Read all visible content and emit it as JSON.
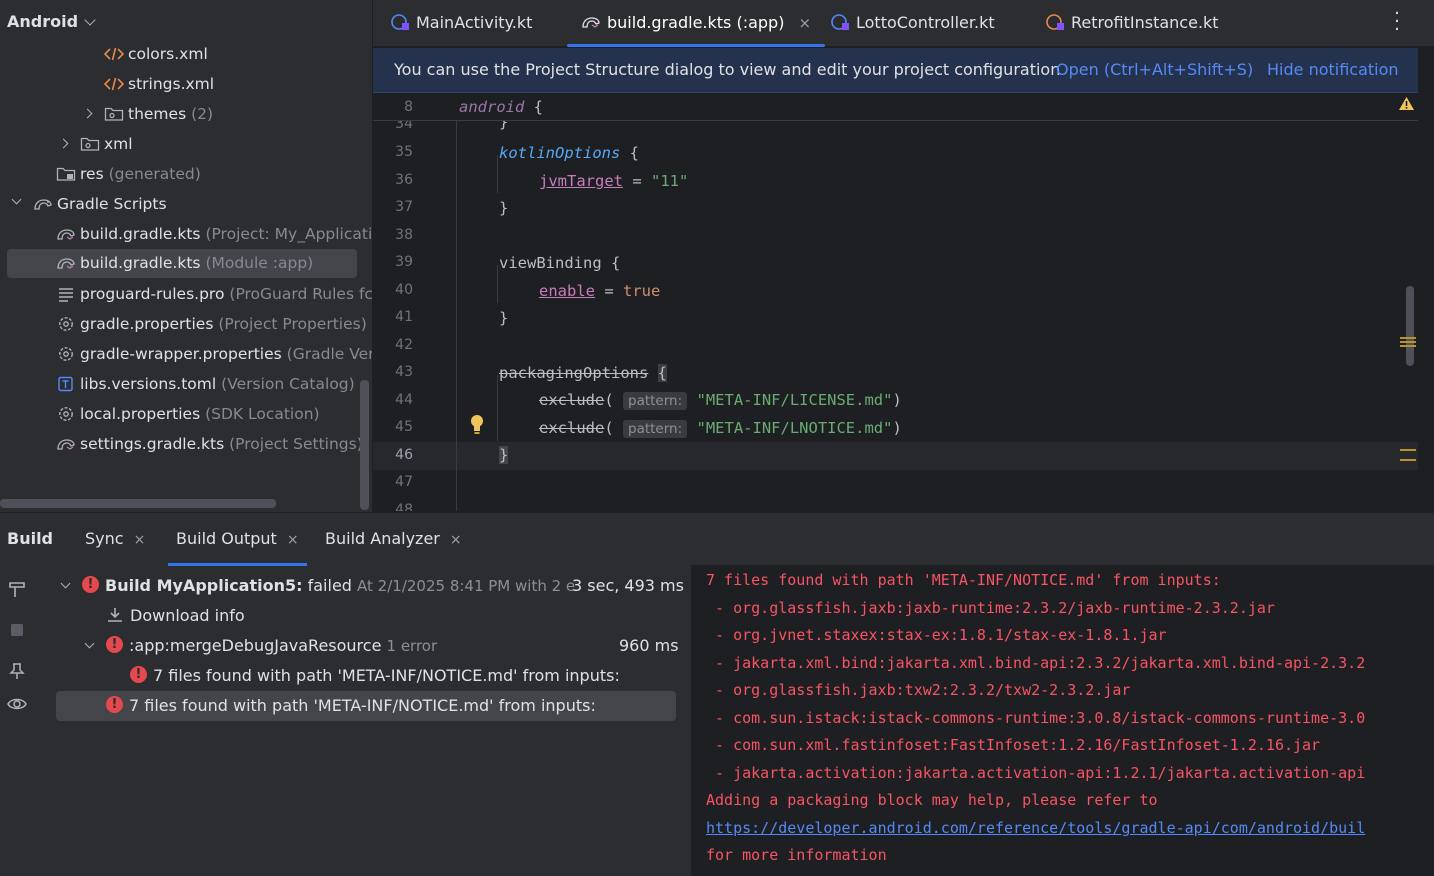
{
  "project_panel": {
    "header": "Android",
    "items": [
      {
        "label": "colors.xml",
        "secondary": "",
        "icon": "xml-file-icon"
      },
      {
        "label": "strings.xml",
        "secondary": "",
        "icon": "xml-file-icon"
      },
      {
        "label": "themes",
        "secondary": "(2)",
        "icon": "folder-icon"
      },
      {
        "label": "xml",
        "secondary": "",
        "icon": "folder-icon"
      },
      {
        "label": "res",
        "secondary": "(generated)",
        "icon": "res-folder-icon"
      },
      {
        "label": "Gradle Scripts",
        "secondary": "",
        "icon": "gradle-icon"
      },
      {
        "label": "build.gradle.kts",
        "secondary": "(Project: My_Applicati",
        "icon": "gradle-icon"
      },
      {
        "label": "build.gradle.kts",
        "secondary": "(Module :app)",
        "icon": "gradle-icon"
      },
      {
        "label": "proguard-rules.pro",
        "secondary": "(ProGuard Rules fc",
        "icon": "text-file-icon"
      },
      {
        "label": "gradle.properties",
        "secondary": "(Project Properties)",
        "icon": "gear-icon"
      },
      {
        "label": "gradle-wrapper.properties",
        "secondary": "(Gradle Ver",
        "icon": "gear-icon"
      },
      {
        "label": "libs.versions.toml",
        "secondary": "(Version Catalog)",
        "icon": "toml-file-icon"
      },
      {
        "label": "local.properties",
        "secondary": "(SDK Location)",
        "icon": "gear-icon"
      },
      {
        "label": "settings.gradle.kts",
        "secondary": "(Project Settings)",
        "icon": "gradle-icon"
      }
    ]
  },
  "editor_tabs": [
    {
      "label": "MainActivity.kt",
      "active": false,
      "icon": "kotlin-class-icon"
    },
    {
      "label": "build.gradle.kts (:app)",
      "active": true,
      "icon": "gradle-icon",
      "close": "×"
    },
    {
      "label": "LottoController.kt",
      "active": false,
      "icon": "kotlin-class-icon"
    },
    {
      "label": "RetrofitInstance.kt",
      "active": false,
      "icon": "kotlin-class-icon"
    }
  ],
  "notification": {
    "message": "You can use the Project Structure dialog to view and edit your project configuration",
    "open_link": "Open (Ctrl+Alt+Shift+S)",
    "hide_link": "Hide notification"
  },
  "editor": {
    "sticky_line": {
      "number": "8",
      "text": "android",
      "brace": "{"
    },
    "line_numbers": [
      "34",
      "35",
      "36",
      "37",
      "38",
      "39",
      "40",
      "41",
      "42",
      "43",
      "44",
      "45",
      "46",
      "47",
      "48"
    ],
    "current_line": "46",
    "code": {
      "l35_fn": "kotlinOptions",
      "l36_prop": "jvmTarget",
      "l36_val": "\"11\"",
      "l39_fn": "viewBinding",
      "l40_prop": "enable",
      "l40_val": "true",
      "l43_fn": "packagingOptions",
      "exclude_fn": "exclude",
      "hint": "pattern:",
      "l44_str": "\"META-INF/LICENSE.md\"",
      "l45_str": "\"META-INF/LNOTICE.md\""
    }
  },
  "build": {
    "title": "Build",
    "tabs": [
      {
        "label": "Sync",
        "close": "×"
      },
      {
        "label": "Build Output",
        "close": "×",
        "active": true
      },
      {
        "label": "Build Analyzer",
        "close": "×"
      }
    ],
    "tree": {
      "root_label": "Build MyApplication5:",
      "root_status": "failed",
      "root_detail": "At 2/1/2025 8:41 PM with 2 e",
      "root_time": "3 sec, 493 ms",
      "download": "Download info",
      "task": ":app:mergeDebugJavaResource",
      "task_errors": "1 error",
      "task_time": "960 ms",
      "child_error": "7 files found with path 'META-INF/NOTICE.md' from inputs:",
      "selected_error": "7 files found with path 'META-INF/NOTICE.md' from inputs:"
    },
    "output_lines": [
      "7 files found with path 'META-INF/NOTICE.md' from inputs:",
      " - org.glassfish.jaxb:jaxb-runtime:2.3.2/jaxb-runtime-2.3.2.jar",
      " - org.jvnet.staxex:stax-ex:1.8.1/stax-ex-1.8.1.jar",
      " - jakarta.xml.bind:jakarta.xml.bind-api:2.3.2/jakarta.xml.bind-api-2.3.2",
      " - org.glassfish.jaxb:txw2:2.3.2/txw2-2.3.2.jar",
      " - com.sun.istack:istack-commons-runtime:3.0.8/istack-commons-runtime-3.0",
      " - com.sun.xml.fastinfoset:FastInfoset:1.2.16/FastInfoset-1.2.16.jar",
      " - jakarta.activation:jakarta.activation-api:1.2.1/jakarta.activation-api",
      "Adding a packaging block may help, please refer to",
      "https://developer.android.com/reference/tools/gradle-api/com/android/buil",
      "for more information"
    ]
  },
  "colors": {
    "accent": "#3574f0",
    "error": "#e5484d",
    "output_error_text": "#f75464",
    "link": "#548af7"
  }
}
